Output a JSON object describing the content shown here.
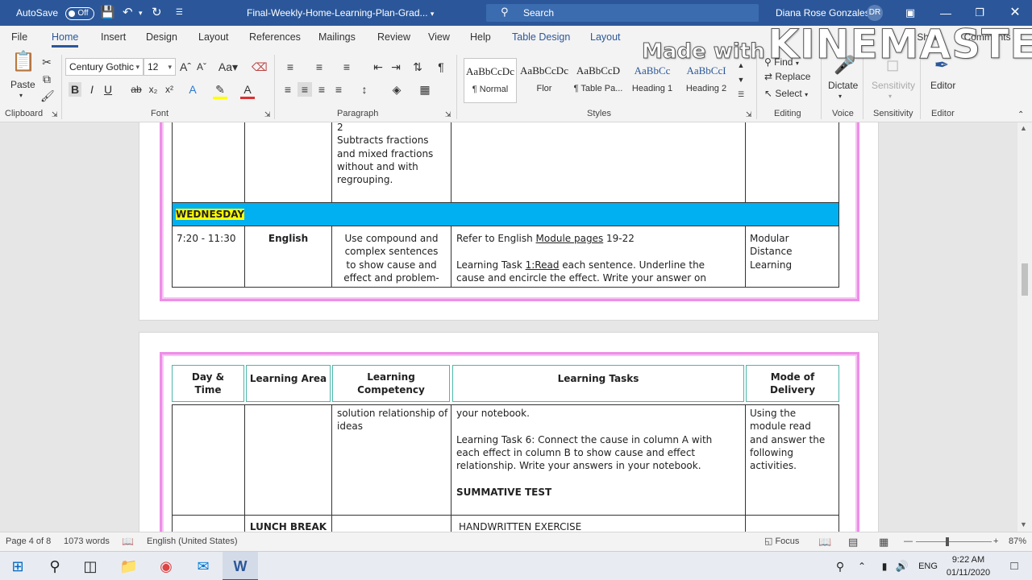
{
  "titlebar": {
    "autosave_label": "AutoSave",
    "autosave_state": "Off",
    "doc_title": "Final-Weekly-Home-Learning-Plan-Grad...",
    "search_placeholder": "Search",
    "user_name": "Diana Rose Gonzales",
    "user_initials": "DR"
  },
  "tabs": [
    "File",
    "Home",
    "Insert",
    "Design",
    "Layout",
    "References",
    "Mailings",
    "Review",
    "View",
    "Help",
    "Table Design",
    "Layout"
  ],
  "right_tabs": {
    "share": "Share",
    "comments": "Comments"
  },
  "ribbon": {
    "clipboard": {
      "paste": "Paste",
      "label": "Clipboard"
    },
    "font": {
      "name": "Century Gothic",
      "size": "12",
      "label": "Font"
    },
    "paragraph": {
      "label": "Paragraph"
    },
    "styles": {
      "label": "Styles",
      "items": [
        {
          "sample": "AaBbCcDc",
          "name": "¶ Normal"
        },
        {
          "sample": "AaBbCcDc",
          "name": "Flor"
        },
        {
          "sample": "AaBbCcD",
          "name": "¶ Table Pa..."
        },
        {
          "sample": "AaBbCc",
          "name": "Heading 1"
        },
        {
          "sample": "AaBbCcI",
          "name": "Heading 2"
        }
      ]
    },
    "editing": {
      "find": "Find",
      "replace": "Replace",
      "select": "Select",
      "label": "Editing"
    },
    "voice": {
      "dictate": "Dictate",
      "label": "Voice"
    },
    "sensitivity": {
      "button": "Sensitivity",
      "label": "Sensitivity"
    },
    "editor": {
      "button": "Editor",
      "label": "Editor"
    }
  },
  "watermark": {
    "small": "Made with",
    "big": "KINEMASTER"
  },
  "page1": {
    "row_top": {
      "competency": [
        "2",
        "Subtracts fractions",
        "and mixed fractions",
        "without and with",
        "regrouping."
      ]
    },
    "day_label": "WEDNESDAY",
    "row_english": {
      "time": "7:20 - 11:30",
      "area": "English",
      "competency": [
        "Use compound and",
        "complex sentences",
        "to show cause and",
        "effect and problem-"
      ],
      "task_line1_a": "Refer to English ",
      "task_line1_link": "Module  pages",
      "task_line1_b": " 19-22",
      "task_line2_a": "Learning Task ",
      "task_line2_link": "1:Read",
      "task_line2_b": " each sentence. Underline the",
      "task_line3": "cause and encircle the effect.  Write your answer on",
      "mode": [
        "Modular",
        "Distance",
        "Learning"
      ]
    }
  },
  "page2": {
    "headers": [
      [
        "Day &",
        "Time"
      ],
      [
        "Learning Area"
      ],
      [
        "Learning",
        "Competency"
      ],
      [
        "Learning Tasks"
      ],
      [
        "Mode of",
        "Delivery"
      ]
    ],
    "row_cont": {
      "competency": [
        "solution relationship of",
        "ideas"
      ],
      "tasks": [
        "your notebook.",
        "",
        "Learning Task 6: Connect the cause in column A with",
        "each effect in column B to show cause and effect",
        "relationship.  Write your answers in your notebook.",
        "",
        "SUMMATIVE TEST"
      ],
      "mode": [
        "Using the",
        "module read",
        "and answer the",
        "following",
        "activities."
      ]
    },
    "row_lunch": {
      "area": "LUNCH BREAK",
      "task": "HANDWRITTEN EXERCISE"
    }
  },
  "status": {
    "page": "Page 4 of 8",
    "words": "1073 words",
    "language": "English (United States)",
    "focus": "Focus",
    "zoom": "87%"
  },
  "taskbar": {
    "lang": "ENG",
    "time": "9:22 AM",
    "date": "01/11/2020"
  }
}
